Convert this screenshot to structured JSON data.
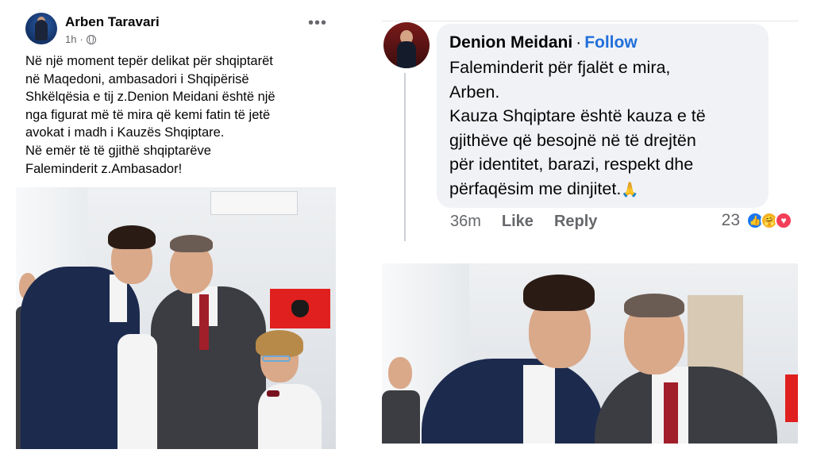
{
  "post": {
    "author": "Arben Taravari",
    "time": "1h",
    "more_icon": "more-horizontal-icon",
    "privacy_icon": "globe-icon",
    "text": "Në një moment tepër delikat për shqiptarët\nnë Maqedoni, ambasadori i Shqipërisë\nShkëlqësia e tij z.Denion Meidani është një\nnga figurat më të mira që kemi fatin të jetë\navokat i madh i Kauzës Shqiptare.\nNë emër të të gjithë shqiptarëve\nFaleminderit z.Ambasador!"
  },
  "comment": {
    "author": "Denion Meidani",
    "separator": "·",
    "follow_label": "Follow",
    "text": "Faleminderit për fjalët e mira,\nArben.\nKauza Shqiptare është kauza e të\ngjithëve që besojnë në të drejtën\npër identitet, barazi, respekt dhe\npërfaqësim me dinjitet.",
    "emoji": "🙏",
    "time": "36m",
    "like_label": "Like",
    "reply_label": "Reply",
    "reaction_count": "23",
    "reaction_icons": [
      "like-icon",
      "care-icon",
      "love-icon"
    ]
  },
  "colors": {
    "link_blue": "#216fdb",
    "bubble_bg": "#f0f2f5",
    "meta_grey": "#65676b"
  }
}
